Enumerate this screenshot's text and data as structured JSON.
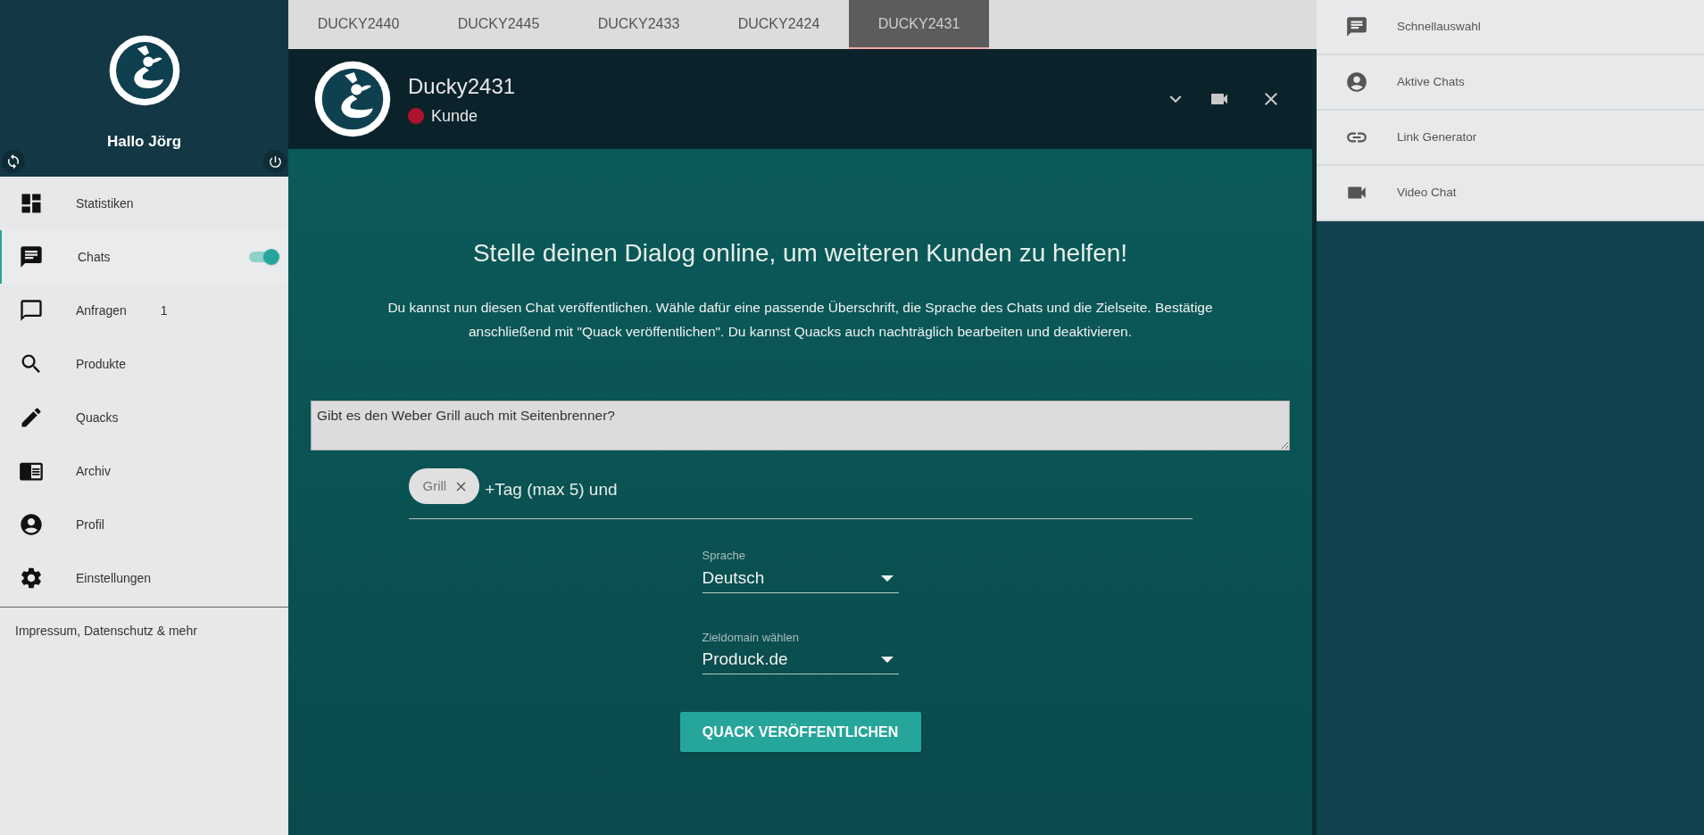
{
  "sidebar": {
    "greeting": "Hallo Jörg",
    "items": [
      {
        "label": "Statistiken",
        "selected": false
      },
      {
        "label": "Chats",
        "selected": true,
        "toggle_on": true
      },
      {
        "label": "Anfragen",
        "selected": false,
        "count": "1"
      },
      {
        "label": "Produkte",
        "selected": false
      },
      {
        "label": "Quacks",
        "selected": false
      },
      {
        "label": "Archiv",
        "selected": false
      },
      {
        "label": "Profil",
        "selected": false
      },
      {
        "label": "Einstellungen",
        "selected": false
      }
    ],
    "footer_link": "Impressum, Datenschutz & mehr"
  },
  "tabs": [
    {
      "label": "DUCKY2440",
      "selected": false
    },
    {
      "label": "DUCKY2445",
      "selected": false
    },
    {
      "label": "DUCKY2433",
      "selected": false
    },
    {
      "label": "DUCKY2424",
      "selected": false
    },
    {
      "label": "DUCKY2431",
      "selected": true
    }
  ],
  "chat_header": {
    "name": "Ducky2431",
    "status": "Kunde"
  },
  "publish": {
    "heading": "Stelle deinen Dialog online, um weiteren Kunden zu helfen!",
    "description": "Du kannst nun diesen Chat veröffentlichen. Wähle dafür eine passende Überschrift, die Sprache des Chats und die Zielseite. Bestätige anschließend mit \"Quack veröffentlichen\". Du kannst Quacks auch nachträglich bearbeiten und deaktivieren.",
    "question": "Gibt es den Weber Grill auch mit Seitenbrenner?",
    "tags": [
      "Grill"
    ],
    "tag_placeholder": "+Tag (max 5) und",
    "language": {
      "label": "Sprache",
      "value": "Deutsch"
    },
    "domain": {
      "label": "Zieldomain wählen",
      "value": "Produck.de"
    },
    "button": "QUACK VERÖFFENTLICHEN"
  },
  "right_panel": {
    "items": [
      "Schnellauswahl",
      "Aktive Chats",
      "Link Generator",
      "Video Chat"
    ]
  }
}
